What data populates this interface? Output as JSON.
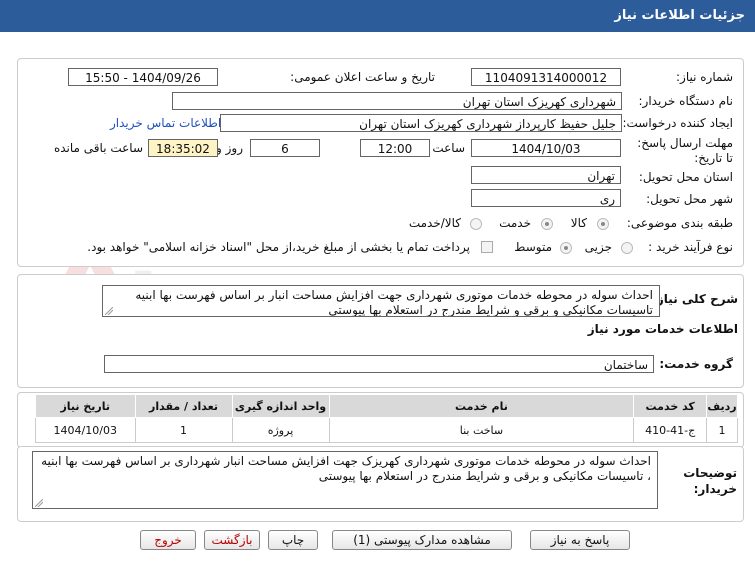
{
  "header": {
    "title": "جزئیات اطلاعات نیاز"
  },
  "form": {
    "need_number_label": "شماره نیاز:",
    "need_number": "1104091314000012",
    "announce_label": "تاریخ و ساعت اعلان عمومی:",
    "announce_value": "1404/09/26 - 15:50",
    "buyer_label": "نام دستگاه خریدار:",
    "buyer_value": "شهرداری کهریزک استان تهران",
    "creator_label": "ایجاد کننده درخواست:",
    "creator_value": "جلیل حفیظ کارپرداز شهرداری کهریزک استان تهران",
    "contact_link": "اطلاعات تماس خریدار",
    "deadline_label": "مهلت ارسال پاسخ: تا تاریخ:",
    "deadline_date": "1404/10/03",
    "time_label": "ساعت",
    "deadline_time": "12:00",
    "days_value": "6",
    "days_label": "روز و",
    "remaining_time": "18:35:02",
    "remaining_label": "ساعت باقی مانده",
    "province_label": "استان محل تحویل:",
    "province_value": "تهران",
    "city_label": "شهر محل تحویل:",
    "city_value": "ری",
    "category_label": "طبقه بندی موضوعی:",
    "category_options": [
      "کالا",
      "خدمت",
      "کالا/خدمت"
    ],
    "process_label": "نوع فرآیند خرید :",
    "process_options": [
      "جزیی",
      "متوسط"
    ],
    "payment_note": "پرداخت تمام یا بخشی از مبلغ خرید،از محل \"اسناد خزانه اسلامی\" خواهد بود."
  },
  "summary": {
    "label": "شرح کلی نیاز:",
    "text": "احداث سوله در محوطه خدمات موتوری شهرداری جهت افزایش مساحت انبار بر اساس فهرست بها ابنیه تاسیسات مکانیکی و برقی و شرایط مندرج در استعلام بها پیوستی"
  },
  "services": {
    "section_title": "اطلاعات خدمات مورد نیاز",
    "group_label": "گروه خدمت:",
    "group_value": "ساختمان",
    "columns": [
      "ردیف",
      "کد خدمت",
      "نام خدمت",
      "واحد اندازه گیری",
      "تعداد / مقدار",
      "تاریخ نیاز"
    ],
    "rows": [
      {
        "row": "1",
        "code": "ج-41-410",
        "name": "ساخت بنا",
        "unit": "پروژه",
        "qty": "1",
        "date": "1404/10/03"
      }
    ]
  },
  "buyer_notes": {
    "label": "توضیحات خریدار:",
    "text": "احداث سوله در محوطه خدمات موتوری شهرداری کهریزک جهت افزایش مساحت انبار شهرداری بر اساس فهرست بها ابنیه ، تاسیسات مکانیکی و برقی و شرایط مندرج در استعلام بها پیوستی"
  },
  "buttons": {
    "reply": "پاسخ به نیاز",
    "view_docs": "مشاهده مدارک پیوستی (1)",
    "print": "چاپ",
    "back": "بازگشت",
    "exit": "خروج"
  },
  "watermark": {
    "text": "AriaTender.net"
  }
}
